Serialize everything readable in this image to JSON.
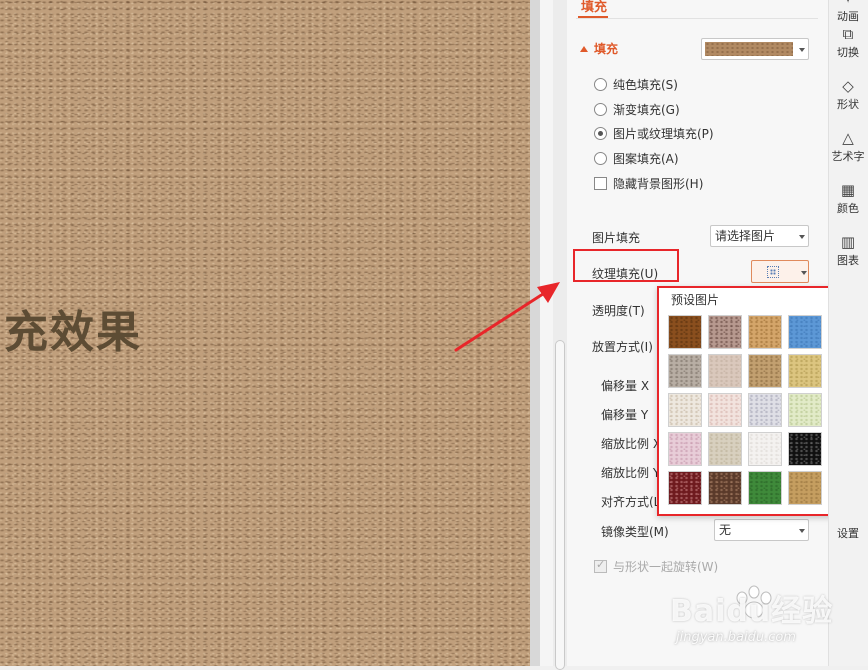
{
  "canvas": {
    "text": "充效果"
  },
  "panel": {
    "tab_label": "填充",
    "section_label": "填充",
    "options": {
      "solid": "纯色填充(S)",
      "gradient": "渐变填充(G)",
      "picture_texture": "图片或纹理填充(P)",
      "pattern": "图案填充(A)",
      "hide_bg": "隐藏背景图形(H)"
    },
    "picture_fill_label": "图片填充",
    "picture_fill_value": "请选择图片",
    "texture_fill_label": "纹理填充(U)",
    "transparency_label": "透明度(T)",
    "placement_label": "放置方式(I)",
    "offset_x_label": "偏移量 X",
    "offset_y_label": "偏移量 Y",
    "scale_x_label": "缩放比例 X",
    "scale_y_label": "缩放比例 Y",
    "align_label": "对齐方式(L)",
    "mirror_label": "镜像类型(M)",
    "mirror_value": "无",
    "rotate_with_shape": "与形状一起旋转(W)"
  },
  "texture_popup": {
    "title": "预设图片",
    "textures": [
      {
        "color": "#8a4f1e",
        "accent": "#5c3310"
      },
      {
        "color": "#b7998f",
        "accent": "#6a4c45"
      },
      {
        "color": "#d4a56a",
        "accent": "#a07238"
      },
      {
        "color": "#5d98d6",
        "accent": "#3f78b8"
      },
      {
        "color": "#c6a47c",
        "accent": "#8e6a44"
      },
      {
        "color": "#b8aea4",
        "accent": "#7e746a"
      },
      {
        "color": "#dac8bc",
        "accent": "#c2afa0"
      },
      {
        "color": "#c2a070",
        "accent": "#8d6d42"
      },
      {
        "color": "#dcc580",
        "accent": "#b29b52"
      },
      {
        "color": "#5a2a10",
        "accent": "#c07a30"
      },
      {
        "color": "#eee8df",
        "accent": "#c8b9a6"
      },
      {
        "color": "#f2e3de",
        "accent": "#d8b6b0"
      },
      {
        "color": "#dfdfe6",
        "accent": "#a8a8b8"
      },
      {
        "color": "#e2ebc8",
        "accent": "#b7c690"
      },
      {
        "color": "#dde1ea",
        "accent": "#a9b1c4"
      },
      {
        "color": "#e8cdd8",
        "accent": "#c89aae"
      },
      {
        "color": "#d8d0bf",
        "accent": "#bdb29a"
      },
      {
        "color": "#f4f2f0",
        "accent": "#dedad6"
      },
      {
        "color": "#101010",
        "accent": "#6e6e6e"
      },
      {
        "color": "#4a2a22",
        "accent": "#a78478"
      },
      {
        "color": "#6e1a1e",
        "accent": "#c0787a"
      },
      {
        "color": "#5a3a2a",
        "accent": "#a57c62"
      },
      {
        "color": "#3f8a3a",
        "accent": "#2b6628"
      },
      {
        "color": "#c59e60",
        "accent": "#9a7640"
      }
    ]
  },
  "rail": {
    "items": [
      {
        "icon": "animation-icon",
        "label": "动画"
      },
      {
        "icon": "switch-icon",
        "label": "切换"
      },
      {
        "icon": "shape-icon",
        "label": "形状"
      },
      {
        "icon": "wordart-icon",
        "label": "艺术字"
      },
      {
        "icon": "color-icon",
        "label": "颜色"
      },
      {
        "icon": "chart-icon",
        "label": "图表"
      },
      {
        "icon": "settings-icon",
        "label": "设置"
      }
    ]
  },
  "watermark": {
    "brand": "Baidu经验",
    "url": "jingyan.baidu.com"
  },
  "colors": {
    "accent": "#e05a2b",
    "highlight": "#e8262a"
  }
}
